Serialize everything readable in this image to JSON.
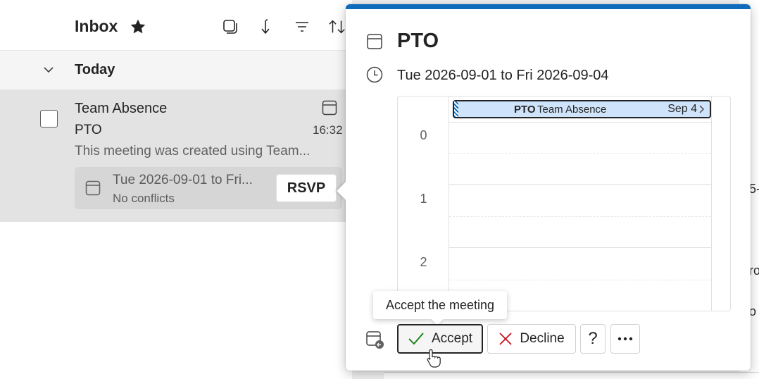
{
  "list": {
    "title": "Inbox",
    "group_label": "Today",
    "message": {
      "sender": "Team Absence",
      "subject": "PTO",
      "time": "16:32",
      "preview": "This meeting was created using Team...",
      "rsvp_card": {
        "dates": "Tue 2026-09-01 to Fri...",
        "conflicts": "No conflicts",
        "rsvp_label": "RSVP"
      }
    }
  },
  "background_fragments": [
    "5-",
    "ro",
    "o"
  ],
  "popup": {
    "title": "PTO",
    "when": "Tue 2026-09-01 to Fri 2026-09-04",
    "hours": [
      "0",
      "1",
      "2"
    ],
    "event": {
      "title": "PTO",
      "sender": "Team Absence",
      "end": "Sep 4"
    },
    "tooltip": "Accept the meeting",
    "buttons": {
      "accept": "Accept",
      "decline": "Decline",
      "help": "?"
    }
  },
  "colors": {
    "accent": "#0f6cbd",
    "selected_row": "#e3e3e3",
    "event_fill": "#cfe4fa",
    "accept_check": "#107c10",
    "decline_x": "#c50f1f"
  }
}
